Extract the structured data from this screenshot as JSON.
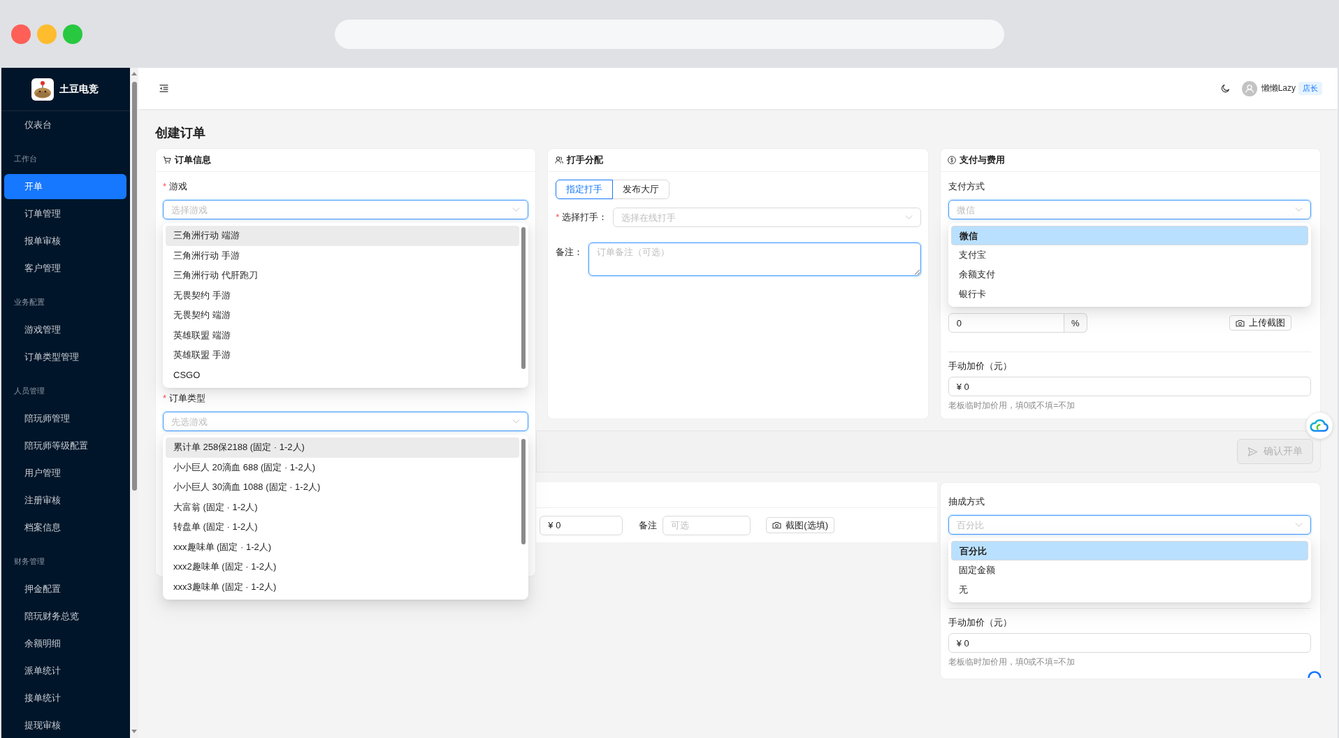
{
  "window_controls": [
    {
      "color": "#fe5f57"
    },
    {
      "color": "#febc2e"
    },
    {
      "color": "#28c840"
    }
  ],
  "sidebar": {
    "brand": "土豆电竞",
    "items": [
      {
        "kind": "item",
        "label": "仪表台",
        "selected": false
      },
      {
        "kind": "group",
        "label": "工作台"
      },
      {
        "kind": "item",
        "label": "开单",
        "selected": true
      },
      {
        "kind": "item",
        "label": "订单管理",
        "selected": false
      },
      {
        "kind": "item",
        "label": "报单审核",
        "selected": false
      },
      {
        "kind": "item",
        "label": "客户管理",
        "selected": false
      },
      {
        "kind": "group",
        "label": "业务配置"
      },
      {
        "kind": "item",
        "label": "游戏管理",
        "selected": false
      },
      {
        "kind": "item",
        "label": "订单类型管理",
        "selected": false
      },
      {
        "kind": "group",
        "label": "人员管理"
      },
      {
        "kind": "item",
        "label": "陪玩师管理",
        "selected": false
      },
      {
        "kind": "item",
        "label": "陪玩师等级配置",
        "selected": false
      },
      {
        "kind": "item",
        "label": "用户管理",
        "selected": false
      },
      {
        "kind": "item",
        "label": "注册审核",
        "selected": false
      },
      {
        "kind": "item",
        "label": "档案信息",
        "selected": false
      },
      {
        "kind": "group",
        "label": "财务管理"
      },
      {
        "kind": "item",
        "label": "押金配置",
        "selected": false
      },
      {
        "kind": "item",
        "label": "陪玩财务总览",
        "selected": false
      },
      {
        "kind": "item",
        "label": "余额明细",
        "selected": false
      },
      {
        "kind": "item",
        "label": "派单统计",
        "selected": false
      },
      {
        "kind": "item",
        "label": "接单统计",
        "selected": false
      },
      {
        "kind": "item",
        "label": "提现审核",
        "selected": false
      }
    ]
  },
  "header": {
    "user_name": "懒懒Lazy",
    "role_badge": "店长"
  },
  "page_title": "创建订单",
  "order_info": {
    "title": "订单信息",
    "game": {
      "required_mark": "*",
      "label": "游戏",
      "placeholder": "选择游戏",
      "focused": true,
      "options": [
        {
          "label": "三角洲行动 端游",
          "selected": false,
          "active": true
        },
        {
          "label": "三角洲行动 手游",
          "selected": false,
          "active": false
        },
        {
          "label": "三角洲行动 代肝跑刀",
          "selected": false,
          "active": false
        },
        {
          "label": "无畏契约 手游",
          "selected": false,
          "active": false
        },
        {
          "label": "无畏契约 端游",
          "selected": false,
          "active": false
        },
        {
          "label": "英雄联盟 端游",
          "selected": false,
          "active": false
        },
        {
          "label": "英雄联盟 手游",
          "selected": false,
          "active": false
        },
        {
          "label": "CSGO",
          "selected": false,
          "active": false
        }
      ]
    },
    "order_type": {
      "required_mark": "*",
      "label": "订单类型",
      "placeholder": "先选游戏",
      "focused": true,
      "options": [
        {
          "label": "累计单 258保2188 (固定 · 1-2人)",
          "selected": false,
          "active": true
        },
        {
          "label": "小小巨人 20滴血 688 (固定 · 1-2人)",
          "selected": false,
          "active": false
        },
        {
          "label": "小小巨人 30滴血 1088 (固定 · 1-2人)",
          "selected": false,
          "active": false
        },
        {
          "label": "大富翁 (固定 · 1-2人)",
          "selected": false,
          "active": false
        },
        {
          "label": "转盘单 (固定 · 1-2人)",
          "selected": false,
          "active": false
        },
        {
          "label": "xxx趣味单 (固定 · 1-2人)",
          "selected": false,
          "active": false
        },
        {
          "label": "xxx2趣味单 (固定 · 1-2人)",
          "selected": false,
          "active": false
        },
        {
          "label": "xxx3趣味单 (固定 · 1-2人)",
          "selected": false,
          "active": false
        }
      ]
    }
  },
  "assignment": {
    "title": "打手分配",
    "modes": [
      {
        "label": "指定打手",
        "selected": true
      },
      {
        "label": "发布大厅",
        "selected": false
      }
    ],
    "player": {
      "required_mark": "*",
      "label": "选择打手：",
      "placeholder": "选择在线打手",
      "focused": false
    },
    "note": {
      "label": "备注：",
      "placeholder": "订单备注（可选）",
      "focused": true
    }
  },
  "payment": {
    "title": "支付与费用",
    "method": {
      "label": "支付方式",
      "placeholder": "微信",
      "focused": true,
      "options": [
        {
          "label": "微信",
          "selected": true
        },
        {
          "label": "支付宝",
          "selected": false
        },
        {
          "label": "余额支付",
          "selected": false
        },
        {
          "label": "银行卡",
          "selected": false
        }
      ]
    },
    "rate": {
      "value": "0",
      "unit": "%"
    },
    "upload_button": "上传截图",
    "surcharge": {
      "label": "手动加价（元）",
      "value": "¥ 0",
      "hint": "老板临时加价用，填0或不填=不加"
    }
  },
  "actions": {
    "confirm": {
      "label": "确认开单",
      "disabled": true
    }
  },
  "extra_row": {
    "amount": {
      "value": "¥ 0"
    },
    "note": {
      "label": "备注",
      "placeholder": "可选"
    },
    "screenshot_button": "截图(选填)"
  },
  "commission": {
    "method": {
      "label": "抽成方式",
      "placeholder": "百分比",
      "focused": true,
      "options": [
        {
          "label": "百分比",
          "selected": true
        },
        {
          "label": "固定金额",
          "selected": false
        },
        {
          "label": "无",
          "selected": false
        }
      ]
    },
    "surcharge": {
      "label": "手动加价（元）",
      "value": "¥ 0",
      "hint": "老板临时加价用，填0或不填=不加"
    }
  }
}
